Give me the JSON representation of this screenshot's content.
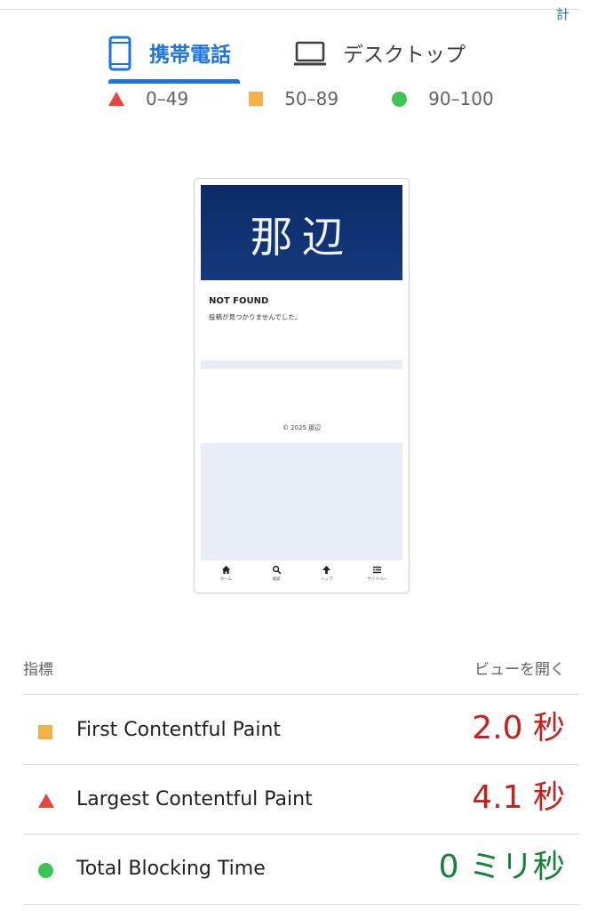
{
  "header": {
    "corner_glyph": "計"
  },
  "tabs": [
    {
      "label": "携帯電話",
      "icon": "smartphone-icon",
      "selected": true
    },
    {
      "label": "デスクトップ",
      "icon": "laptop-icon",
      "selected": false
    }
  ],
  "legend": [
    {
      "label": "0–49",
      "icon": "triangle-fail-icon",
      "color": "#e8453c"
    },
    {
      "label": "50–89",
      "icon": "square-average-icon",
      "color": "#f4b147"
    },
    {
      "label": "90–100",
      "icon": "circle-pass-icon",
      "color": "#3cc454"
    }
  ],
  "screenshot": {
    "site_title": "那辺",
    "heading": "NOT FOUND",
    "message": "投稿が見つかりませんでした。",
    "copyright": "© 2025 那辺",
    "nav": [
      {
        "label": "ホーム",
        "icon": "home-icon"
      },
      {
        "label": "検索",
        "icon": "search-icon"
      },
      {
        "label": "トップ",
        "icon": "arrow-up-icon"
      },
      {
        "label": "サイドバー",
        "icon": "list-icon"
      }
    ]
  },
  "metrics": {
    "header_label": "指標",
    "open_view_label": "ビューを開く",
    "items": [
      {
        "name": "First Contentful Paint",
        "value": "2.0 秒",
        "rating": "average",
        "color": "#c5221f"
      },
      {
        "name": "Largest Contentful Paint",
        "value": "4.1 秒",
        "rating": "fail",
        "color": "#c5221f"
      },
      {
        "name": "Total Blocking Time",
        "value": "0 ミリ秒",
        "rating": "pass",
        "color": "#188038"
      }
    ]
  },
  "colors": {
    "accent": "#1a73e8",
    "fail": "#e8453c",
    "average": "#f4b147",
    "pass": "#3cc454",
    "screenshot_header": "#0c2b66"
  }
}
